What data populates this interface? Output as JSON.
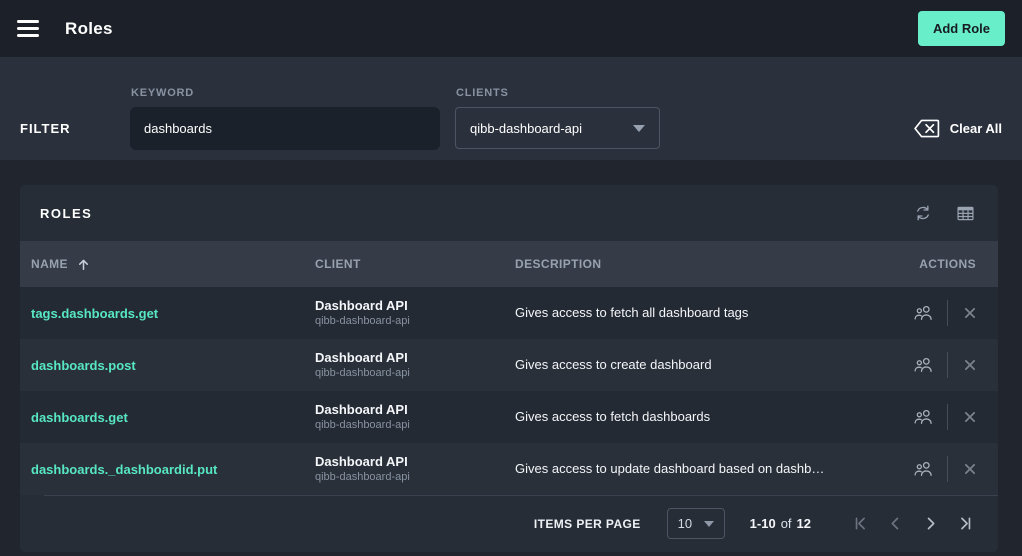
{
  "app": {
    "header": {
      "title": "Roles",
      "add_role_button": "Add Role"
    }
  },
  "filter": {
    "section_label": "FILTER",
    "keyword": {
      "label": "KEYWORD",
      "value": "dashboards"
    },
    "clients": {
      "label": "CLIENTS",
      "selected": "qibb-dashboard-api"
    },
    "clear_all_label": "Clear All"
  },
  "roles_card": {
    "title": "ROLES",
    "columns": {
      "name": "NAME",
      "client": "CLIENT",
      "description": "DESCRIPTION",
      "actions": "ACTIONS"
    },
    "rows": [
      {
        "name": "tags.dashboards.get",
        "client_name": "Dashboard API",
        "client_id": "qibb-dashboard-api",
        "description": "Gives access to fetch all dashboard tags"
      },
      {
        "name": "dashboards.post",
        "client_name": "Dashboard API",
        "client_id": "qibb-dashboard-api",
        "description": "Gives access to create dashboard"
      },
      {
        "name": "dashboards.get",
        "client_name": "Dashboard API",
        "client_id": "qibb-dashboard-api",
        "description": "Gives access to fetch dashboards"
      },
      {
        "name": "dashboards._dashboardid.put",
        "client_name": "Dashboard API",
        "client_id": "qibb-dashboard-api",
        "description": "Gives access to update dashboard based on dashb…"
      }
    ]
  },
  "pagination": {
    "items_per_page_label": "ITEMS PER PAGE",
    "page_size": "10",
    "range": "1-10",
    "of_label": "of",
    "total": "12"
  },
  "icons": {
    "menu": "hamburger-icon",
    "clear": "backspace-icon",
    "clients_dropdown": "chevron-down-icon",
    "refresh": "sync-icon",
    "layout": "table-grid-icon",
    "sort": "arrow-up-icon",
    "assign_users": "group-icon",
    "remove_role": "x-icon",
    "first_page": "first-page-icon",
    "previous_page": "chevron-left-icon",
    "next_page": "chevron-right-icon",
    "last_page": "last-page-icon"
  },
  "colors": {
    "accent_mint": "#68eec9",
    "role_link": "#57e7c1",
    "appbar_bg": "#1b2029",
    "filter_bg": "#2b313c",
    "page_bg": "#20252e",
    "card_bg": "#262d37",
    "table_header_bg": "#353c47",
    "row_odd_bg": "#242a33",
    "row_even_bg": "#293039"
  }
}
